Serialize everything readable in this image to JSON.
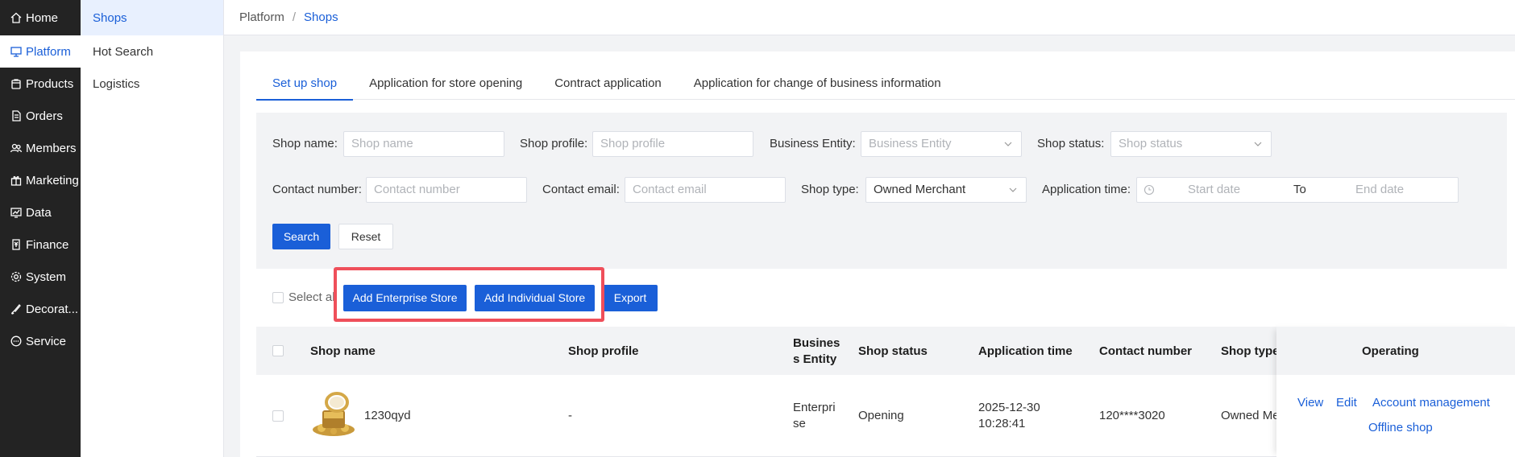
{
  "nav": {
    "items": [
      {
        "label": "Home",
        "icon": "home-icon"
      },
      {
        "label": "Platform",
        "icon": "platform-icon"
      },
      {
        "label": "Products",
        "icon": "bag-icon"
      },
      {
        "label": "Orders",
        "icon": "document-icon"
      },
      {
        "label": "Members",
        "icon": "users-icon"
      },
      {
        "label": "Marketing",
        "icon": "gift-icon"
      },
      {
        "label": "Data",
        "icon": "chart-icon"
      },
      {
        "label": "Finance",
        "icon": "finance-icon"
      },
      {
        "label": "System",
        "icon": "gear-icon"
      },
      {
        "label": "Decorat...",
        "icon": "brush-icon"
      },
      {
        "label": "Service",
        "icon": "chat-icon"
      }
    ]
  },
  "subnav": {
    "items": [
      {
        "label": "Shops"
      },
      {
        "label": "Hot Search"
      },
      {
        "label": "Logistics"
      }
    ]
  },
  "breadcrumb": {
    "platform": "Platform",
    "separator": "/",
    "current": "Shops"
  },
  "tabs": [
    {
      "label": "Set up shop"
    },
    {
      "label": "Application for store opening"
    },
    {
      "label": "Contract application"
    },
    {
      "label": "Application for change of business information"
    }
  ],
  "filters": {
    "shop_name": {
      "label": "Shop name:",
      "placeholder": "Shop name"
    },
    "shop_profile": {
      "label": "Shop profile:",
      "placeholder": "Shop profile"
    },
    "business_entity": {
      "label": "Business Entity:",
      "placeholder": "Business Entity"
    },
    "shop_status": {
      "label": "Shop status:",
      "placeholder": "Shop status"
    },
    "contact_number": {
      "label": "Contact number:",
      "placeholder": "Contact number"
    },
    "contact_email": {
      "label": "Contact email:",
      "placeholder": "Contact email"
    },
    "shop_type": {
      "label": "Shop type:",
      "value": "Owned Merchant"
    },
    "application_time": {
      "label": "Application time:",
      "start_placeholder": "Start date",
      "to": "To",
      "end_placeholder": "End date"
    },
    "search_label": "Search",
    "reset_label": "Reset"
  },
  "actions": {
    "select_all": "Select all",
    "add_enterprise": "Add Enterprise Store",
    "add_individual": "Add Individual Store",
    "export": "Export"
  },
  "table": {
    "headers": {
      "shop_name": "Shop name",
      "shop_profile": "Shop profile",
      "business_entity_1": "Busines",
      "business_entity_2": "s Entity",
      "shop_status": "Shop status",
      "application_time": "Application time",
      "contact_number": "Contact number",
      "shop_type": "Shop type",
      "operating": "Operating"
    },
    "rows": [
      {
        "shop_name": "1230qyd",
        "shop_profile": "-",
        "business_entity_1": "Enterpri",
        "business_entity_2": "se",
        "shop_status": "Opening",
        "date": "2025-12-30",
        "time": "10:28:41",
        "contact_number": "120****3020",
        "shop_type": "Owned Mer",
        "ops": {
          "view": "View",
          "edit": "Edit",
          "account": "Account management",
          "offline": "Offline shop"
        }
      }
    ]
  },
  "colors": {
    "accent": "#1a5fd8",
    "highlight": "#ef4f5a",
    "nav_bg": "#232323"
  }
}
